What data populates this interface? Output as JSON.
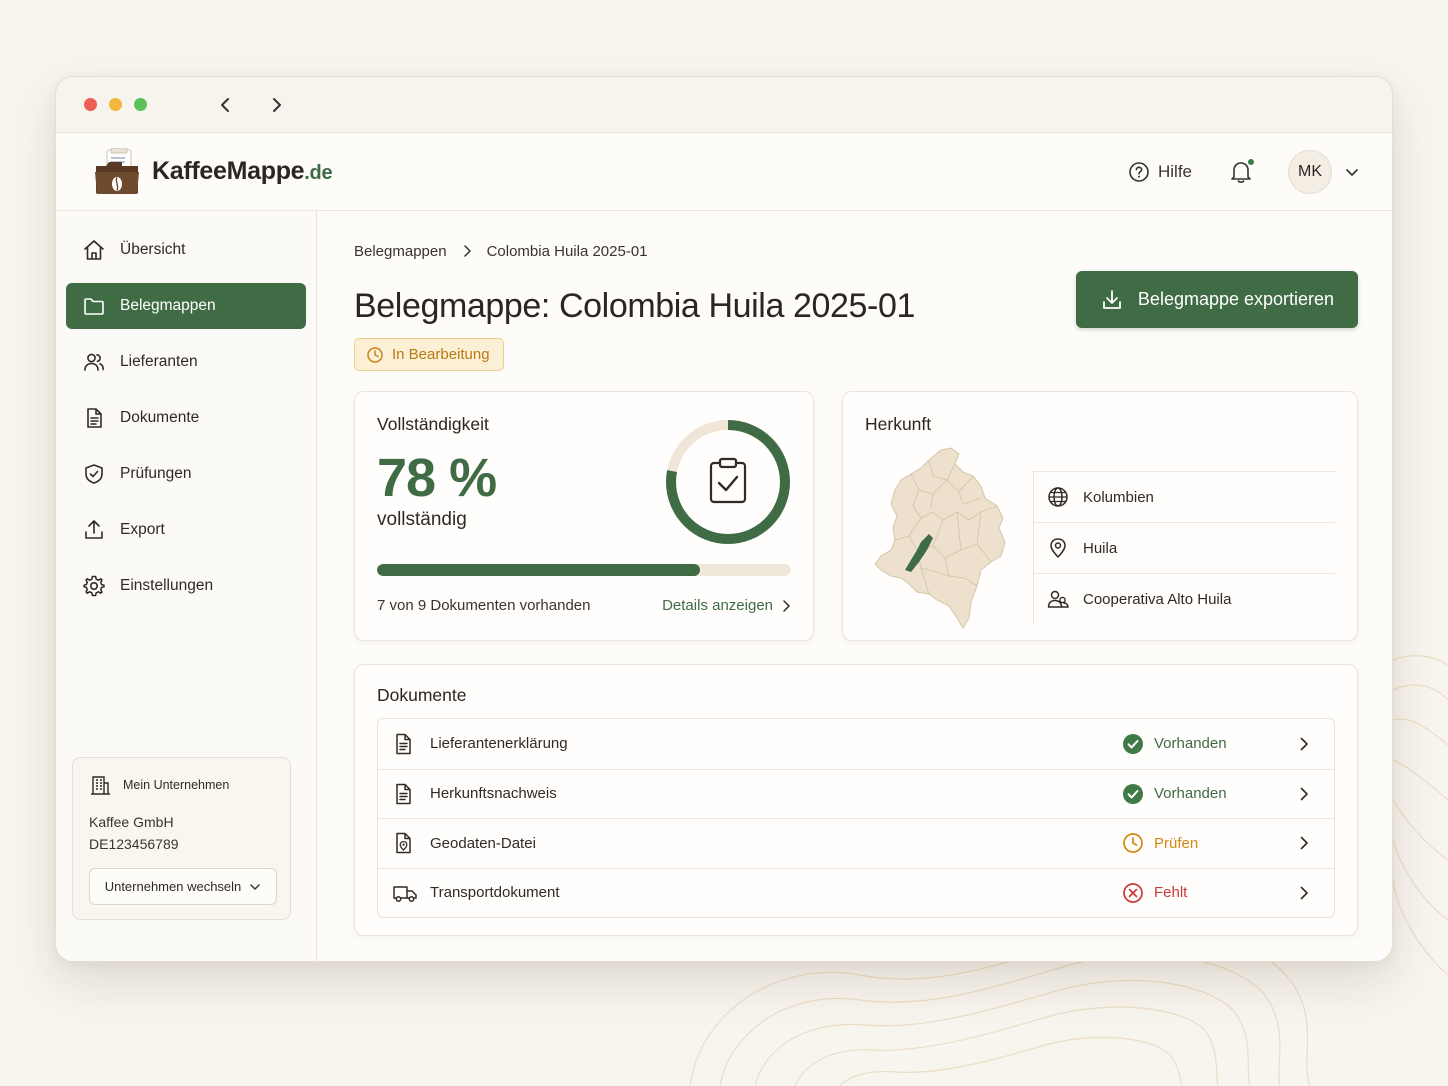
{
  "app": {
    "name": "KaffeeMappe",
    "tld": ".de"
  },
  "header": {
    "help_label": "Hilfe",
    "avatar_initials": "MK"
  },
  "sidebar": {
    "items": [
      {
        "label": "Übersicht",
        "icon": "home-icon"
      },
      {
        "label": "Belegmappen",
        "icon": "folder-icon",
        "active": true
      },
      {
        "label": "Lieferanten",
        "icon": "users-icon"
      },
      {
        "label": "Dokumente",
        "icon": "document-icon"
      },
      {
        "label": "Prüfungen",
        "icon": "shield-check-icon"
      },
      {
        "label": "Export",
        "icon": "upload-icon"
      },
      {
        "label": "Einstellungen",
        "icon": "gear-icon"
      }
    ],
    "company": {
      "heading": "Mein Unternehmen",
      "name": "Kaffee GmbH",
      "id": "DE123456789",
      "switch_label": "Unternehmen wechseln"
    }
  },
  "breadcrumb": {
    "parent": "Belegmappen",
    "current": "Colombia Huila 2025-01"
  },
  "page": {
    "title": "Belegmappe: Colombia Huila 2025-01",
    "status": "In Bearbeitung",
    "export_label": "Belegmappe exportieren"
  },
  "completeness": {
    "title": "Vollständigkeit",
    "percent_label": "78 %",
    "percent": 0.78,
    "subtitle": "vollständig",
    "summary": "7 von 9 Dokumenten vorhanden",
    "details_label": "Details anzeigen"
  },
  "origin": {
    "title": "Herkunft",
    "country": "Kolumbien",
    "region": "Huila",
    "cooperative": "Cooperativa Alto Huila"
  },
  "documents": {
    "title": "Dokumente",
    "rows": [
      {
        "name": "Lieferantenerklärung",
        "status": "Vorhanden",
        "state": "ok",
        "icon": "document-icon"
      },
      {
        "name": "Herkunftsnachweis",
        "status": "Vorhanden",
        "state": "ok",
        "icon": "document-icon"
      },
      {
        "name": "Geodaten-Datei",
        "status": "Prüfen",
        "state": "check",
        "icon": "geo-file-icon"
      },
      {
        "name": "Transportdokument",
        "status": "Fehlt",
        "state": "missing",
        "icon": "truck-icon"
      }
    ]
  },
  "colors": {
    "primary": "#3f6b45",
    "warning": "#d08a14",
    "error": "#c93a3a",
    "success": "#3f6b45",
    "background": "#f8f5ef"
  }
}
